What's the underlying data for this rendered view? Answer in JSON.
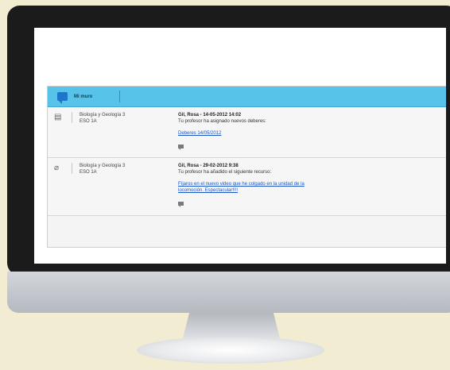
{
  "wall": {
    "title": "Mi muro",
    "posts": [
      {
        "icon": "book-icon",
        "subject": "Biología y Geología 3",
        "group": "ESO 1A",
        "author_date": "Gil, Rosa - 14-05-2012 14:02",
        "message": "Tu profesor ha asignado nuevos deberes:",
        "link_line1": "Deberes 14/05/2012",
        "link_line2": ""
      },
      {
        "icon": "paperclip-icon",
        "subject": "Biología y Geología 3",
        "group": "ESO 1A",
        "author_date": "Gil, Rosa - 29-02-2012 9:38",
        "message": "Tu profesor ha añadido el siguiente recurso:",
        "link_line1": "Fíjaros en el nuevo video que he colgado en la unidad de la",
        "link_line2": "locomoción. Espectacular!!!!"
      }
    ]
  },
  "colors": {
    "header": "#58c3e8",
    "link": "#1a55c9",
    "bezel": "#1b1b1b",
    "background": "#f2ecd3"
  }
}
